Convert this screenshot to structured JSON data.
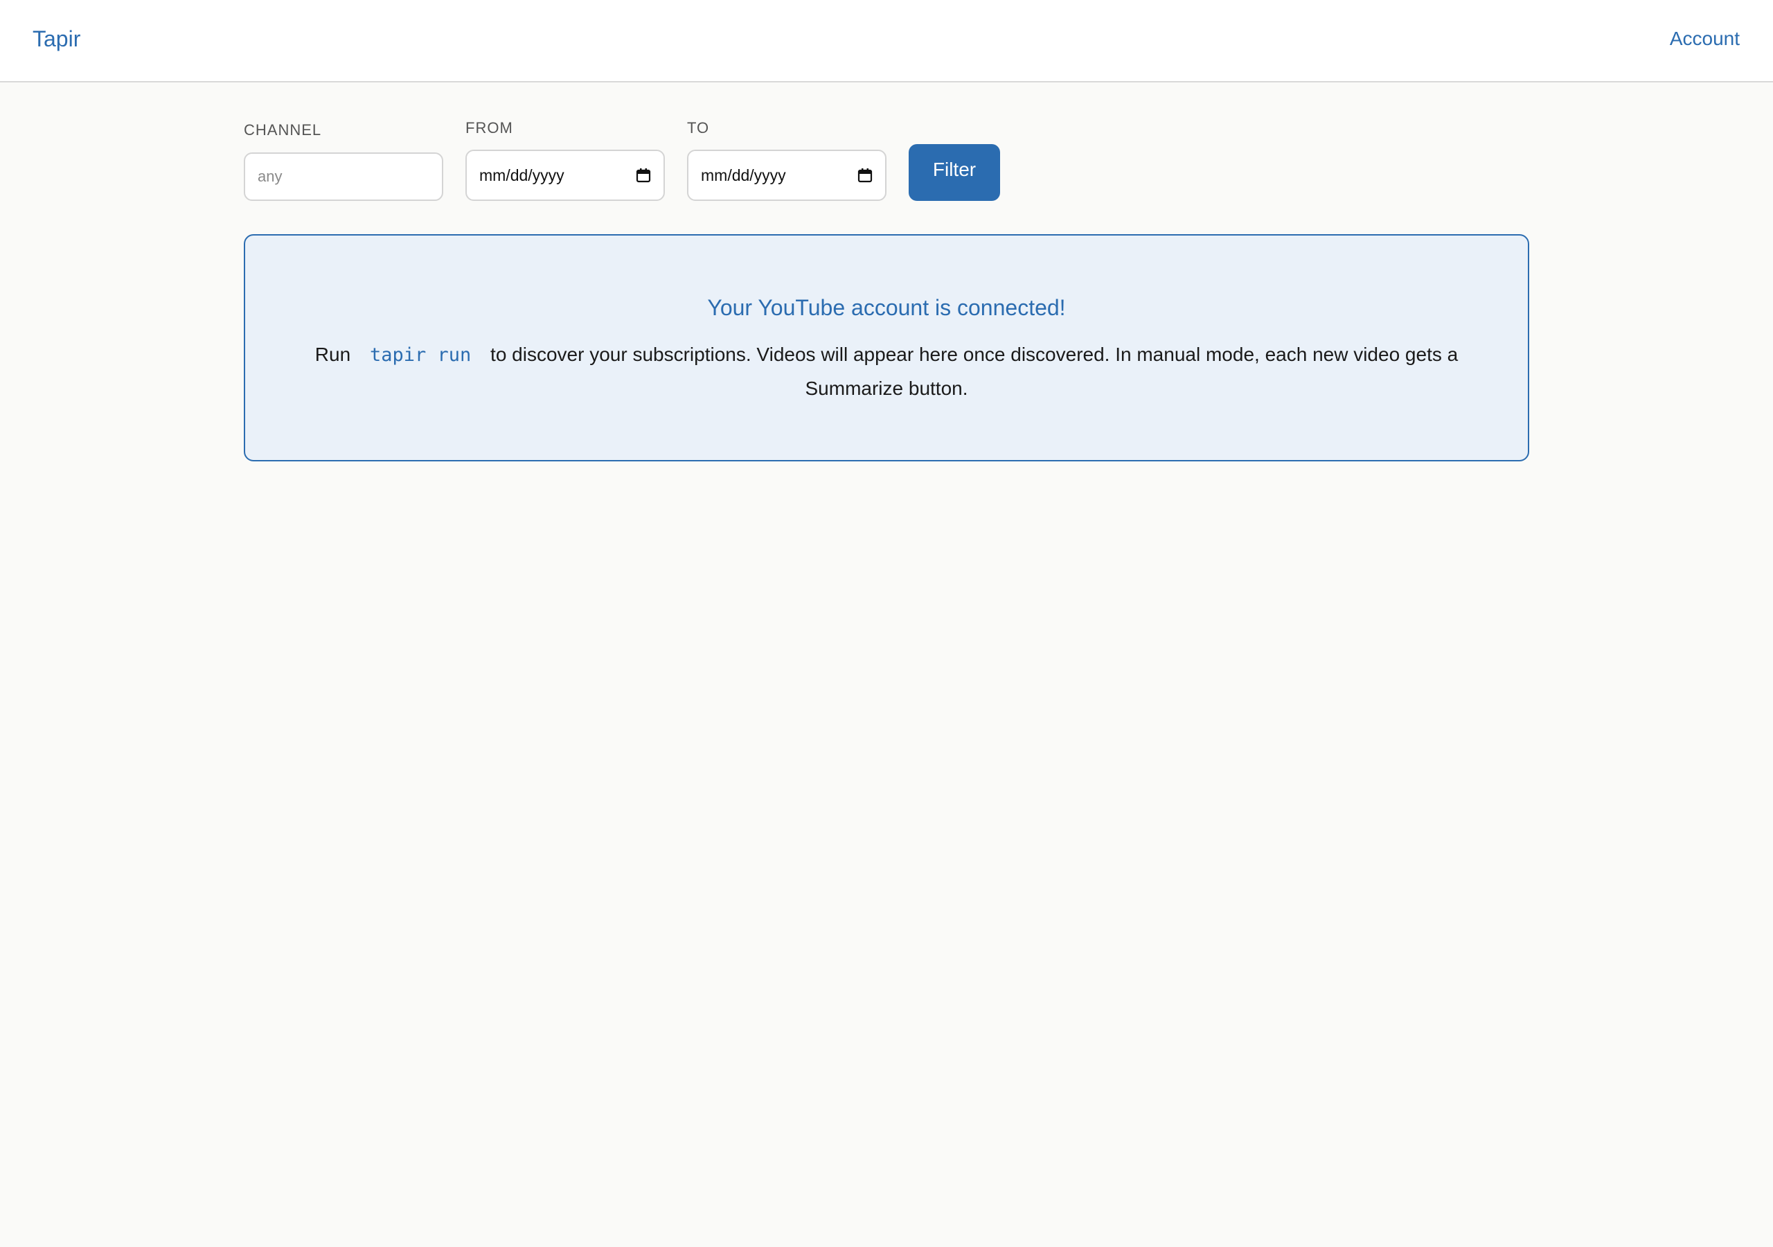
{
  "header": {
    "brand": "Tapir",
    "account_link": "Account"
  },
  "filters": {
    "channel": {
      "label": "CHANNEL",
      "placeholder": "any"
    },
    "from": {
      "label": "FROM",
      "value": "mm/dd/yyyy"
    },
    "to": {
      "label": "TO",
      "value": "mm/dd/yyyy"
    },
    "filter_button": "Filter"
  },
  "notice": {
    "title": "Your YouTube account is connected!",
    "body_before": "Run",
    "command": "tapir run",
    "body_after": "to discover your subscriptions. Videos will appear here once discovered. In manual mode, each new video gets a Summarize button."
  },
  "colors": {
    "accent": "#2b6cb0",
    "notice_background": "#eaf1f9",
    "page_background": "#fafaf8"
  }
}
